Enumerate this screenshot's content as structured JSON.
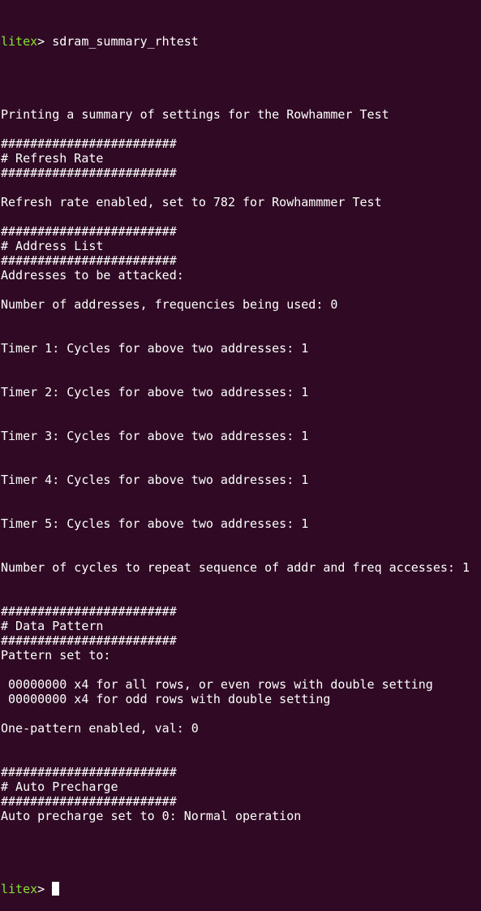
{
  "terminal": {
    "prompt": {
      "name": "litex",
      "symbol": "> "
    },
    "command": "sdram_summary_rhtest",
    "lines": [
      "",
      "",
      "Printing a summary of settings for the Rowhammer Test",
      "",
      "########################",
      "# Refresh Rate",
      "########################",
      "",
      "Refresh rate enabled, set to 782 for Rowhammmer Test",
      "",
      "########################",
      "# Address List",
      "########################",
      "Addresses to be attacked:",
      "",
      "Number of addresses, frequencies being used: 0",
      "",
      "",
      "Timer 1: Cycles for above two addresses: 1",
      "",
      "",
      "Timer 2: Cycles for above two addresses: 1",
      "",
      "",
      "Timer 3: Cycles for above two addresses: 1",
      "",
      "",
      "Timer 4: Cycles for above two addresses: 1",
      "",
      "",
      "Timer 5: Cycles for above two addresses: 1",
      "",
      "",
      "Number of cycles to repeat sequence of addr and freq accesses: 1",
      "",
      "",
      "########################",
      "# Data Pattern",
      "########################",
      "Pattern set to:",
      "",
      " 00000000 x4 for all rows, or even rows with double setting",
      " 00000000 x4 for odd rows with double setting",
      "",
      "One-pattern enabled, val: 0",
      "",
      "",
      "########################",
      "# Auto Precharge",
      "########################",
      "Auto precharge set to 0: Normal operation",
      "",
      ""
    ]
  },
  "colors": {
    "background": "#300a24",
    "text": "#ffffff",
    "prompt": "#8ae234"
  }
}
